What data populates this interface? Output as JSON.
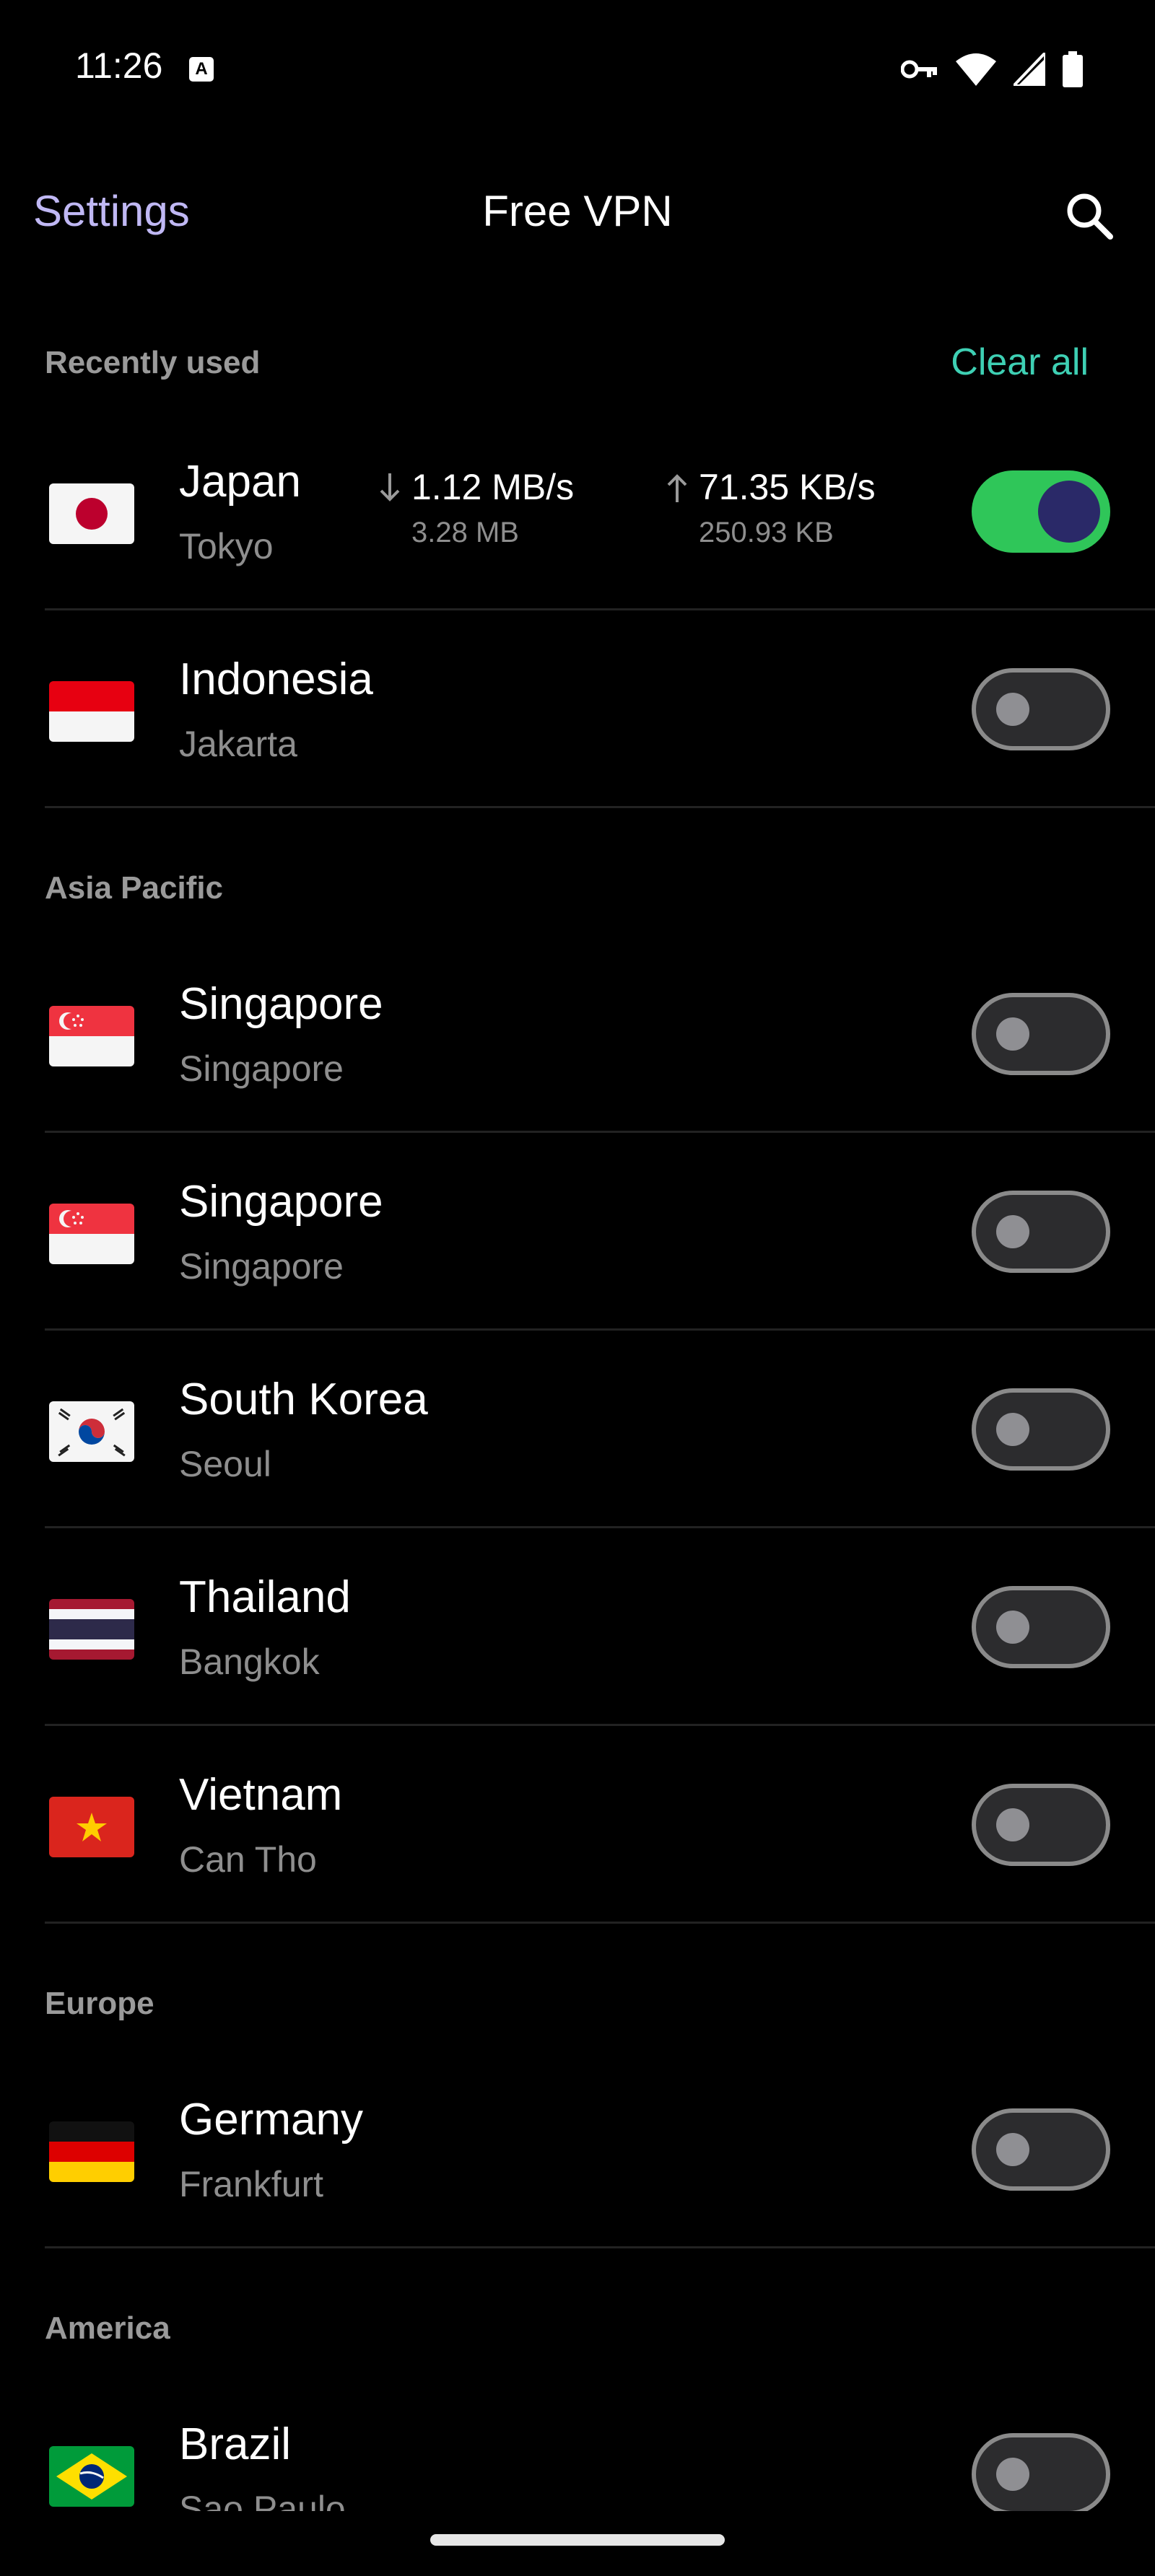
{
  "status_bar": {
    "time": "11:26",
    "icons": [
      "a-notification-icon",
      "vpn-key-icon",
      "wifi-icon",
      "signal-icon",
      "battery-icon"
    ]
  },
  "app_bar": {
    "settings_label": "Settings",
    "title": "Free VPN",
    "search_icon": "search-icon"
  },
  "recent": {
    "header": "Recently used",
    "clear_all_label": "Clear all",
    "items": [
      {
        "country": "Japan",
        "city": "Tokyo",
        "flag": "jp",
        "connected": true,
        "download_rate": "1.12 MB/s",
        "download_total": "3.28 MB",
        "upload_rate": "71.35 KB/s",
        "upload_total": "250.93 KB"
      },
      {
        "country": "Indonesia",
        "city": "Jakarta",
        "flag": "id",
        "connected": false
      }
    ]
  },
  "asia": {
    "header": "Asia Pacific",
    "items": [
      {
        "country": "Singapore",
        "city": "Singapore",
        "flag": "sg",
        "connected": false
      },
      {
        "country": "Singapore",
        "city": "Singapore",
        "flag": "sg",
        "connected": false
      },
      {
        "country": "South Korea",
        "city": "Seoul",
        "flag": "kr",
        "connected": false
      },
      {
        "country": "Thailand",
        "city": "Bangkok",
        "flag": "th",
        "connected": false
      },
      {
        "country": "Vietnam",
        "city": "Can Tho",
        "flag": "vn",
        "connected": false
      }
    ]
  },
  "europe": {
    "header": "Europe",
    "items": [
      {
        "country": "Germany",
        "city": "Frankfurt",
        "flag": "de",
        "connected": false
      }
    ]
  },
  "america": {
    "header": "America",
    "items": [
      {
        "country": "Brazil",
        "city": "Sao Paulo",
        "flag": "br",
        "connected": false
      }
    ]
  },
  "colors": {
    "background": "#000000",
    "accent_settings": "#c0b8f4",
    "accent_clear": "#3ed0b4",
    "toggle_on": "#2fc659",
    "toggle_knob_on": "#2a2968",
    "toggle_off": "#2c2c2e"
  }
}
